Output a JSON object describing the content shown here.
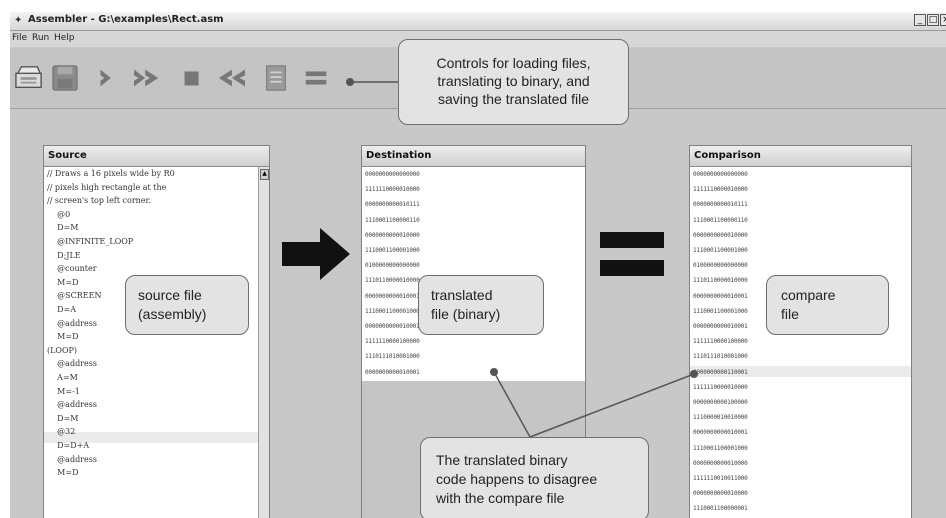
{
  "window": {
    "title": "Assembler - G:\\examples\\Rect.asm"
  },
  "menu": [
    "File",
    "Run",
    "Help"
  ],
  "toolbar_icons": [
    "load-file-icon",
    "save-file-icon",
    "single-step-icon",
    "fast-forward-icon",
    "stop-icon",
    "rewind-icon",
    "load-compare-file-icon",
    "compare-equals-icon"
  ],
  "panels": {
    "source": {
      "title": "Source",
      "lines": [
        "// Draws a 16 pixels wide by R0",
        "// pixels high rectangle at the",
        "// screen's top left corner.",
        "    @0",
        "    D=M",
        "    @INFINITE_LOOP",
        "    D;JLE",
        "    @counter",
        "    M=D",
        "    @SCREEN",
        "    D=A",
        "    @address",
        "    M=D",
        "(LOOP)",
        "    @address",
        "    A=M",
        "    M=-1",
        "    @address",
        "    D=M",
        "    @32",
        "    D=D+A",
        "    @address",
        "    M=D"
      ]
    },
    "destination": {
      "title": "Destination",
      "lines": [
        "0000000000000000",
        "1111110000010000",
        "0000000000010111",
        "1110001100000110",
        "0000000000010000",
        "1110001100001000",
        "0100000000000000",
        "1110110000010000",
        "0000000000010001",
        "1110001100001000",
        "0000000000010001",
        "1111110000100000",
        "1110111010001000",
        "0000000000010001"
      ]
    },
    "comparison": {
      "title": "Comparison",
      "lines": [
        "0000000000000000",
        "1111110000010000",
        "0000000000010111",
        "1110001100000110",
        "0000000000010000",
        "1110001100001000",
        "0100000000000000",
        "1110110000010000",
        "0000000000010001",
        "1110001100001000",
        "0000000000010001",
        "1111110000100000",
        "1110111010001000",
        "0000000000110001",
        "1111110000010000",
        "0000000000100000",
        "1110000010010000",
        "0000000000010001",
        "1110001100001000",
        "0000000000010000",
        "1111110010011000",
        "0000000000010000",
        "1110001100000001"
      ]
    }
  },
  "callouts": {
    "controls": [
      "Controls for loading files,",
      "translating to binary, and",
      "saving the translated file"
    ],
    "source": [
      "source file",
      "(assembly)"
    ],
    "translated": [
      "translated",
      "file (binary)"
    ],
    "compare": [
      "compare",
      "file"
    ],
    "disagree": [
      "The translated binary",
      "code happens to disagree",
      "with the compare file"
    ]
  }
}
